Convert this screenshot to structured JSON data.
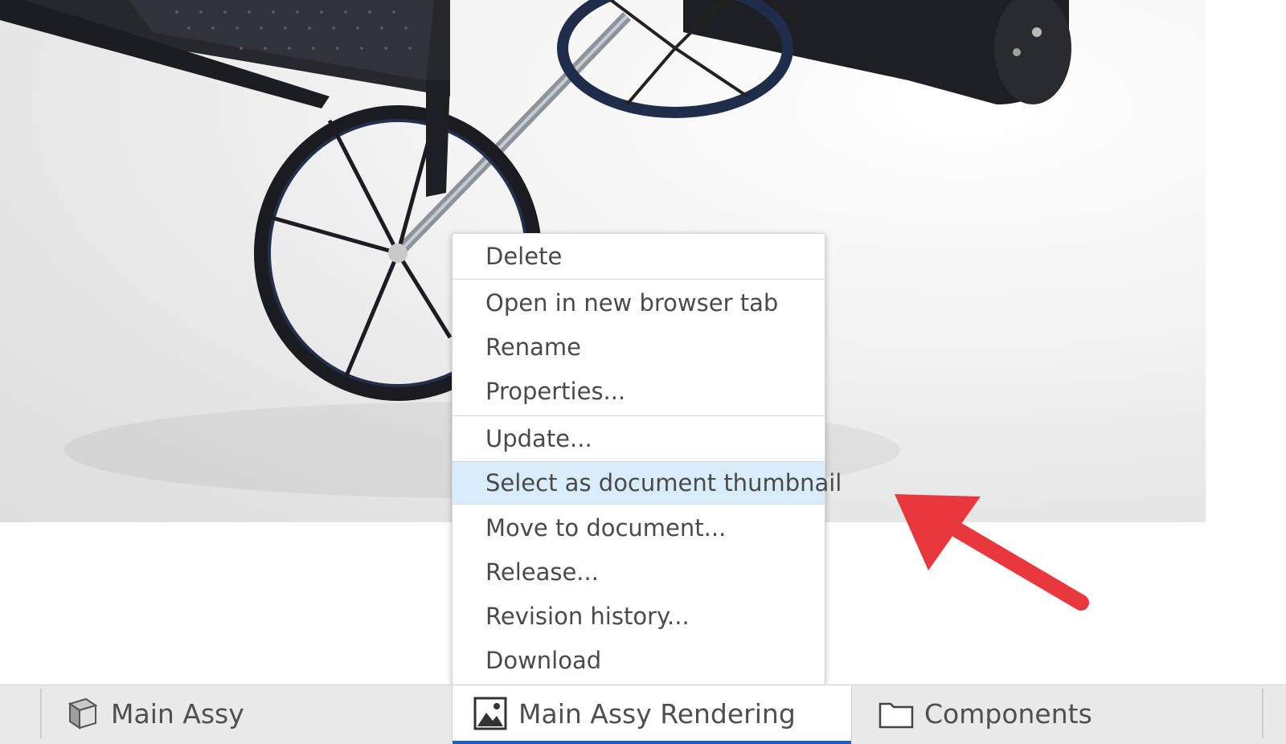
{
  "context_menu": {
    "groups": [
      {
        "items": [
          {
            "label": "Delete"
          }
        ]
      },
      {
        "items": [
          {
            "label": "Open in new browser tab"
          },
          {
            "label": "Rename"
          },
          {
            "label": "Properties..."
          }
        ]
      },
      {
        "items": [
          {
            "label": "Update..."
          }
        ]
      },
      {
        "items": [
          {
            "label": "Select as document thumbnail",
            "highlighted": true
          }
        ]
      },
      {
        "items": [
          {
            "label": "Move to document..."
          },
          {
            "label": "Release..."
          },
          {
            "label": "Revision history..."
          },
          {
            "label": "Download"
          }
        ]
      }
    ]
  },
  "tabs": [
    {
      "label": "Main Assy",
      "icon": "part-studio-cube-icon"
    },
    {
      "label": "Main Assy Rendering",
      "icon": "image-icon",
      "active": true
    },
    {
      "label": "Components",
      "icon": "folder-icon"
    }
  ],
  "colors": {
    "highlight": "#d9ecfa",
    "active_tab_underline": "#1f5fbf",
    "annotation_arrow": "#e8383d"
  }
}
